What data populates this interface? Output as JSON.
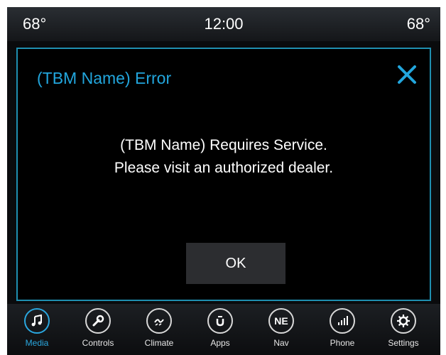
{
  "status_bar": {
    "left_temp": "68°",
    "clock": "12:00",
    "right_temp": "68°"
  },
  "dialog": {
    "title": "(TBM Name) Error",
    "message_line1": "(TBM Name) Requires Service.",
    "message_line2": "Please visit an authorized dealer.",
    "ok_label": "OK",
    "close_icon": "close-icon"
  },
  "nav": {
    "active": "Media",
    "items": [
      {
        "label": "Media",
        "icon": "music-note-icon"
      },
      {
        "label": "Controls",
        "icon": "wrench-icon"
      },
      {
        "label": "Climate",
        "icon": "climate-icon"
      },
      {
        "label": "Apps",
        "icon": "apps-icon"
      },
      {
        "label": "Nav",
        "icon": "compass-icon",
        "glyph": "NE"
      },
      {
        "label": "Phone",
        "icon": "phone-signal-icon"
      },
      {
        "label": "Settings",
        "icon": "gear-icon"
      }
    ]
  },
  "colors": {
    "accent": "#22a6dd",
    "background": "#000000",
    "text": "#ffffff"
  }
}
